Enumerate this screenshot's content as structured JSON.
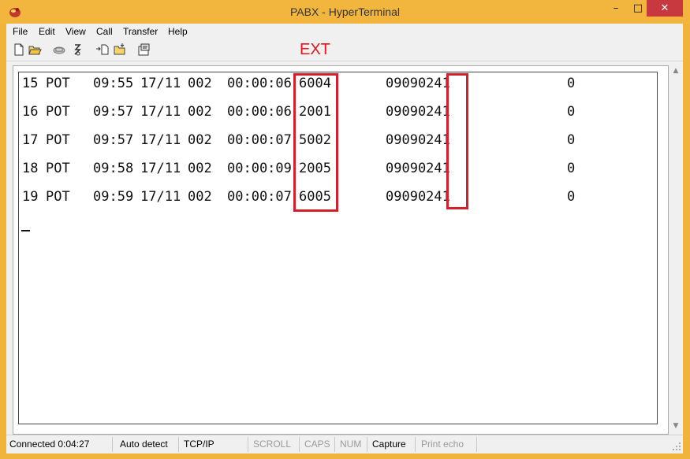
{
  "window": {
    "title": "PABX - HyperTerminal",
    "minimize_symbol": "–",
    "maximize_symbol": "□",
    "close_symbol": "✕"
  },
  "menu": [
    "File",
    "Edit",
    "View",
    "Call",
    "Transfer",
    "Help"
  ],
  "toolbar": {
    "buttons": [
      "new-icon",
      "open-icon",
      "phone-icon",
      "disconnect-icon",
      "send-icon",
      "receive-icon",
      "properties-icon"
    ]
  },
  "annotation": {
    "ext_label": "EXT",
    "color": "#e8141c"
  },
  "terminal": {
    "rows": [
      {
        "seq": "15",
        "type": "POT",
        "time": "09:55",
        "date": "17/11",
        "trunk": "002",
        "duration": "00:00:06",
        "ext": "6004",
        "number": "09090241",
        "cost": "0"
      },
      {
        "seq": "16",
        "type": "POT",
        "time": "09:57",
        "date": "17/11",
        "trunk": "002",
        "duration": "00:00:06",
        "ext": "2001",
        "number": "09090241",
        "cost": "0"
      },
      {
        "seq": "17",
        "type": "POT",
        "time": "09:57",
        "date": "17/11",
        "trunk": "002",
        "duration": "00:00:07",
        "ext": "5002",
        "number": "09090241",
        "cost": "0"
      },
      {
        "seq": "18",
        "type": "POT",
        "time": "09:58",
        "date": "17/11",
        "trunk": "002",
        "duration": "00:00:09",
        "ext": "2005",
        "number": "09090241",
        "cost": "0"
      },
      {
        "seq": "19",
        "type": "POT",
        "time": "09:59",
        "date": "17/11",
        "trunk": "002",
        "duration": "00:00:07",
        "ext": "6005",
        "number": "09090241",
        "cost": "0"
      }
    ],
    "cursor": "_"
  },
  "statusbar": {
    "connected": "Connected 0:04:27",
    "detect": "Auto detect",
    "protocol": "TCP/IP",
    "scroll": "SCROLL",
    "caps": "CAPS",
    "num": "NUM",
    "capture": "Capture",
    "print_echo": "Print echo"
  },
  "colors": {
    "title_bar": "#f2b63e",
    "close_button": "#c7383f",
    "highlight_box": "#d4202a"
  }
}
